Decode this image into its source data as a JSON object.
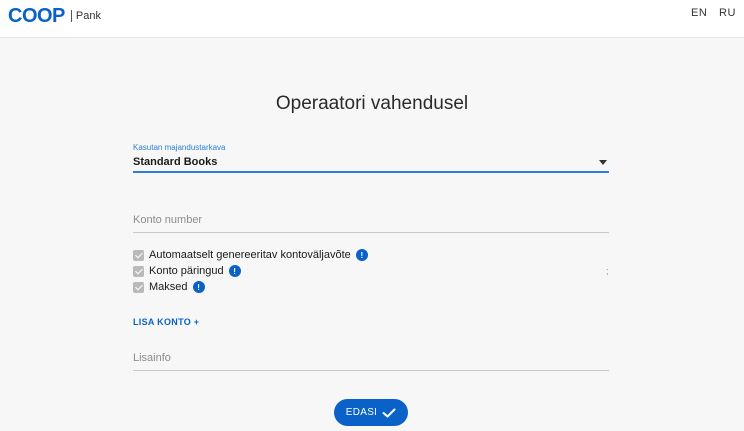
{
  "header": {
    "logo_text": "COOP",
    "logo_sub": "Pank",
    "languages": [
      "EN",
      "RU"
    ]
  },
  "form": {
    "title": "Operaatori vahendusel",
    "software_select": {
      "label": "Kasutan majandustarkava",
      "value": "Standard Books"
    },
    "account_number": {
      "placeholder": "Konto number"
    },
    "checkboxes": [
      {
        "label": "Automaatselt genereeritav kontoväljavõte",
        "checked": true,
        "info": true
      },
      {
        "label": "Konto päringud",
        "checked": true,
        "info": true
      },
      {
        "label": "Maksed",
        "checked": true,
        "info": true
      }
    ],
    "stray_mark": ";",
    "add_account_link": "LISA KONTO +",
    "extra_info": {
      "placeholder": "Lisainfo"
    },
    "next_button": "EDASI"
  },
  "colors": {
    "brand_blue": "#0a62c9",
    "focus_blue": "#2d7fd3",
    "background": "#f7f7f7"
  }
}
